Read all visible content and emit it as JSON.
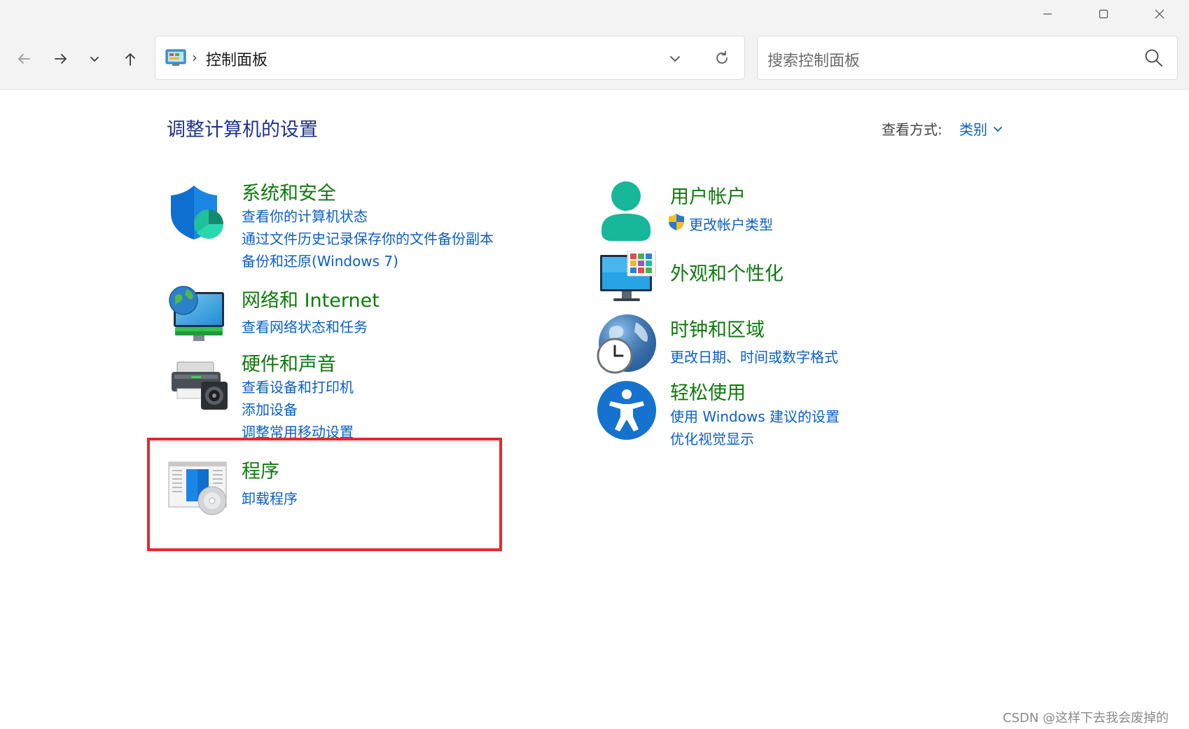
{
  "window": {
    "minimize_icon": "minimize-icon",
    "maximize_icon": "maximize-icon",
    "close_icon": "close-icon"
  },
  "nav": {
    "back_icon": "arrow-left-icon",
    "forward_icon": "arrow-right-icon",
    "recent_icon": "chevron-down-icon",
    "up_icon": "arrow-up-icon"
  },
  "address": {
    "icon": "control-panel-icon",
    "separator": "›",
    "path": "控制面板"
  },
  "search": {
    "placeholder": "搜索控制面板"
  },
  "main": {
    "title": "调整计算机的设置",
    "view_by_label": "查看方式:",
    "view_by_value": "类别"
  },
  "categories": {
    "system": {
      "title": "系统和安全",
      "links": [
        "查看你的计算机状态",
        "通过文件历史记录保存你的文件备份副本",
        "备份和还原(Windows 7)"
      ]
    },
    "network": {
      "title": "网络和 Internet",
      "links": [
        "查看网络状态和任务"
      ]
    },
    "hardware": {
      "title": "硬件和声音",
      "links": [
        "查看设备和打印机",
        "添加设备",
        "调整常用移动设置"
      ]
    },
    "programs": {
      "title": "程序",
      "links": [
        "卸载程序"
      ]
    },
    "accounts": {
      "title": "用户帐户",
      "links": [
        "更改帐户类型"
      ]
    },
    "appearance": {
      "title": "外观和个性化",
      "links": []
    },
    "clock": {
      "title": "时钟和区域",
      "links": [
        "更改日期、时间或数字格式"
      ]
    },
    "ease": {
      "title": "轻松使用",
      "links": [
        "使用 Windows 建议的设置",
        "优化视觉显示"
      ]
    }
  },
  "colors": {
    "category_title": "#0e7a0d",
    "link": "#0a5fc4",
    "page_title": "#1e3287",
    "highlight_box": "#e32a2a"
  },
  "watermark": "CSDN @这样下去我会废掉的"
}
